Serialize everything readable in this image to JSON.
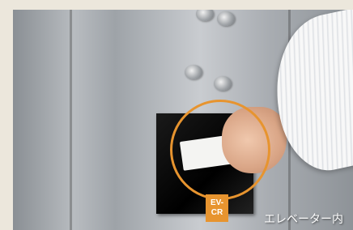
{
  "photo": {
    "tag_line1": "EV-",
    "tag_line2": "CR",
    "caption": "エレベーター内",
    "accent_color": "#e7942f"
  }
}
